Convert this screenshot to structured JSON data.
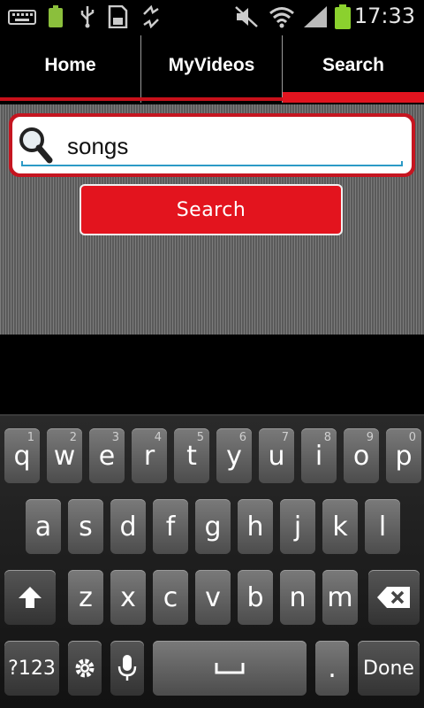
{
  "status_bar": {
    "time": "17:33",
    "left_icons": [
      "keyboard-icon",
      "battery-small-icon",
      "usb-icon",
      "sd-card-icon",
      "sync-icon"
    ],
    "right_icons": [
      "mute-icon",
      "wifi-icon",
      "signal-icon",
      "battery-icon"
    ]
  },
  "tabs": [
    {
      "label": "Home",
      "active": false
    },
    {
      "label": "MyVideos",
      "active": false
    },
    {
      "label": "Search",
      "active": true
    }
  ],
  "search": {
    "value": "songs",
    "button_label": "Search"
  },
  "colors": {
    "accent_red": "#e3141e",
    "tab_underline": "#c8101a",
    "input_underline": "#2c9ac6"
  },
  "keyboard": {
    "row1": [
      {
        "key": "q",
        "sup": "1"
      },
      {
        "key": "w",
        "sup": "2"
      },
      {
        "key": "e",
        "sup": "3"
      },
      {
        "key": "r",
        "sup": "4"
      },
      {
        "key": "t",
        "sup": "5"
      },
      {
        "key": "y",
        "sup": "6"
      },
      {
        "key": "u",
        "sup": "7"
      },
      {
        "key": "i",
        "sup": "8"
      },
      {
        "key": "o",
        "sup": "9"
      },
      {
        "key": "p",
        "sup": "0"
      }
    ],
    "row2": [
      "a",
      "s",
      "d",
      "f",
      "g",
      "h",
      "j",
      "k",
      "l"
    ],
    "row3": [
      "z",
      "x",
      "c",
      "v",
      "b",
      "n",
      "m"
    ],
    "symbols_label": "?123",
    "period_label": ".",
    "done_label": "Done"
  }
}
